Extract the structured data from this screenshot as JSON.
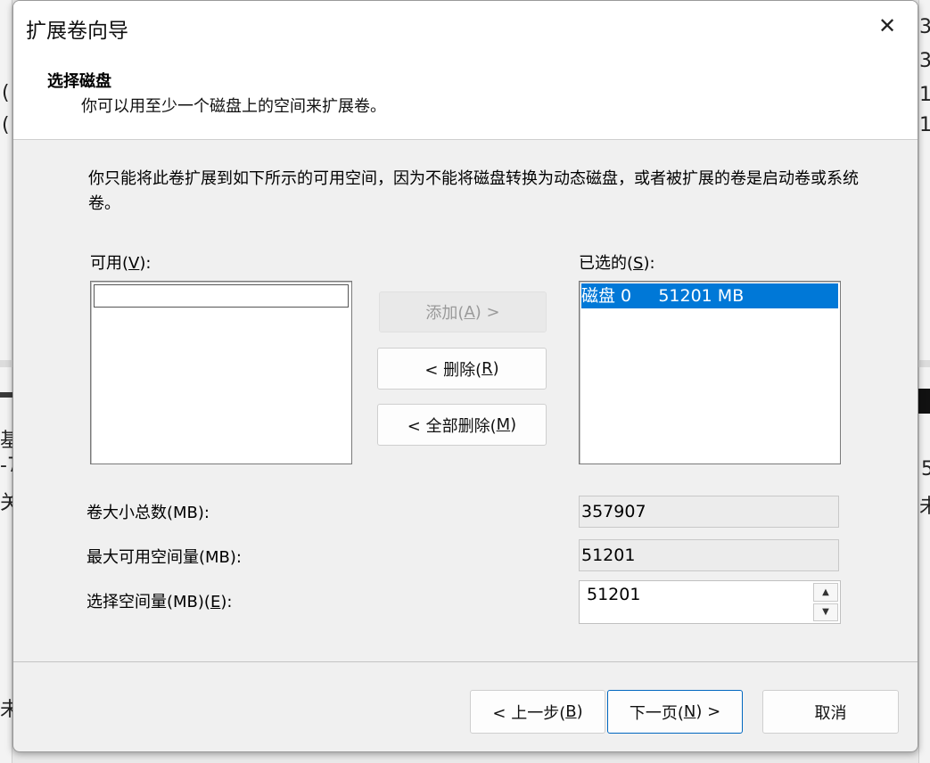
{
  "dialog": {
    "title": "扩展卷向导",
    "close_glyph": "✕"
  },
  "header": {
    "title": "选择磁盘",
    "subtitle": "你可以用至少一个磁盘上的空间来扩展卷。"
  },
  "description": "你只能将此卷扩展到如下所示的可用空间，因为不能将磁盘转换为动态磁盘，或者被扩展的卷是启动卷或系统卷。",
  "available": {
    "label_pre": "可用(",
    "label_key": "V",
    "label_post": "):",
    "items": []
  },
  "selected": {
    "label_pre": "已选的(",
    "label_key": "S",
    "label_post": "):",
    "items": [
      "磁盘 0     51201 MB"
    ]
  },
  "buttons": {
    "add": {
      "pre": "添加(",
      "key": "A",
      "post": ") >"
    },
    "remove": {
      "pre": "< 删除(",
      "key": "R",
      "post": ")"
    },
    "remove_all": {
      "pre": "< 全部删除(",
      "key": "M",
      "post": ")"
    },
    "back": {
      "pre": "< 上一步(",
      "key": "B",
      "post": ")"
    },
    "next": {
      "pre": "下一页(",
      "key": "N",
      "post": ") >"
    },
    "cancel": "取消"
  },
  "fields": {
    "total_label": "卷大小总数(MB):",
    "total_value": "357907",
    "max_label": "最大可用空间量(MB):",
    "max_value": "51201",
    "choose_label_pre": "选择空间量(MB)(",
    "choose_label_key": "E",
    "choose_label_post": "):",
    "choose_value": "51201"
  },
  "background_fragments": {
    "right": [
      "3",
      "3",
      "1",
      "1",
      "5",
      "未"
    ],
    "left": [
      "(",
      "(",
      "基",
      "-7",
      "关",
      "未"
    ]
  },
  "colors": {
    "selection": "#0078d7",
    "default_button_border": "#0067c0"
  }
}
